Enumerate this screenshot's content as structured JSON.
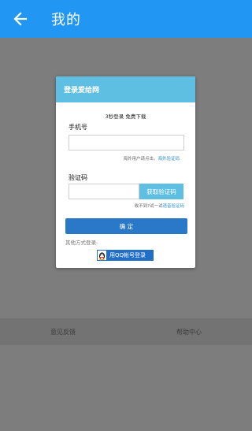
{
  "appbar": {
    "title": "我的",
    "back_icon": "arrow-left-icon",
    "color": "#2196f3"
  },
  "overlay_color": "#7d7d7d",
  "dialog": {
    "header_title": "登录爱给网",
    "header_color": "#5fbfe2",
    "tagline": "3秒登录 免费下载",
    "phone": {
      "label": "手机号",
      "value": "",
      "placeholder": ""
    },
    "overseas_hint": {
      "prefix": "海外用户请点击。",
      "link": "海外验证码"
    },
    "code": {
      "label": "验证码",
      "value": "",
      "placeholder": "",
      "button_label": "获取验证码"
    },
    "voice_hint": {
      "prefix": "收不到?试一试",
      "link": "语音验证码"
    },
    "confirm_label": "确 定",
    "confirm_color": "#2a79c8",
    "other_login_label": "其他方式登录:",
    "qq_login_label": "用QQ帐号登录",
    "qq_icon": "qq-penguin-icon"
  },
  "bottom_band": {
    "left": "意见反馈",
    "right": "帮助中心"
  }
}
